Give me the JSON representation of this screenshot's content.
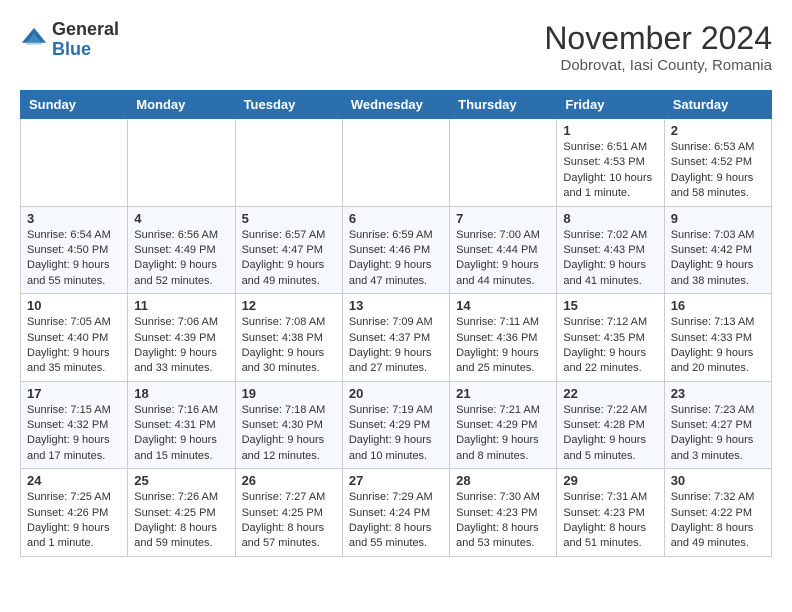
{
  "header": {
    "logo": {
      "general": "General",
      "blue": "Blue"
    },
    "title": "November 2024",
    "subtitle": "Dobrovat, Iasi County, Romania"
  },
  "calendar": {
    "days_of_week": [
      "Sunday",
      "Monday",
      "Tuesday",
      "Wednesday",
      "Thursday",
      "Friday",
      "Saturday"
    ],
    "weeks": [
      [
        {
          "day": "",
          "content": ""
        },
        {
          "day": "",
          "content": ""
        },
        {
          "day": "",
          "content": ""
        },
        {
          "day": "",
          "content": ""
        },
        {
          "day": "",
          "content": ""
        },
        {
          "day": "1",
          "content": "Sunrise: 6:51 AM\nSunset: 4:53 PM\nDaylight: 10 hours and 1 minute."
        },
        {
          "day": "2",
          "content": "Sunrise: 6:53 AM\nSunset: 4:52 PM\nDaylight: 9 hours and 58 minutes."
        }
      ],
      [
        {
          "day": "3",
          "content": "Sunrise: 6:54 AM\nSunset: 4:50 PM\nDaylight: 9 hours and 55 minutes."
        },
        {
          "day": "4",
          "content": "Sunrise: 6:56 AM\nSunset: 4:49 PM\nDaylight: 9 hours and 52 minutes."
        },
        {
          "day": "5",
          "content": "Sunrise: 6:57 AM\nSunset: 4:47 PM\nDaylight: 9 hours and 49 minutes."
        },
        {
          "day": "6",
          "content": "Sunrise: 6:59 AM\nSunset: 4:46 PM\nDaylight: 9 hours and 47 minutes."
        },
        {
          "day": "7",
          "content": "Sunrise: 7:00 AM\nSunset: 4:44 PM\nDaylight: 9 hours and 44 minutes."
        },
        {
          "day": "8",
          "content": "Sunrise: 7:02 AM\nSunset: 4:43 PM\nDaylight: 9 hours and 41 minutes."
        },
        {
          "day": "9",
          "content": "Sunrise: 7:03 AM\nSunset: 4:42 PM\nDaylight: 9 hours and 38 minutes."
        }
      ],
      [
        {
          "day": "10",
          "content": "Sunrise: 7:05 AM\nSunset: 4:40 PM\nDaylight: 9 hours and 35 minutes."
        },
        {
          "day": "11",
          "content": "Sunrise: 7:06 AM\nSunset: 4:39 PM\nDaylight: 9 hours and 33 minutes."
        },
        {
          "day": "12",
          "content": "Sunrise: 7:08 AM\nSunset: 4:38 PM\nDaylight: 9 hours and 30 minutes."
        },
        {
          "day": "13",
          "content": "Sunrise: 7:09 AM\nSunset: 4:37 PM\nDaylight: 9 hours and 27 minutes."
        },
        {
          "day": "14",
          "content": "Sunrise: 7:11 AM\nSunset: 4:36 PM\nDaylight: 9 hours and 25 minutes."
        },
        {
          "day": "15",
          "content": "Sunrise: 7:12 AM\nSunset: 4:35 PM\nDaylight: 9 hours and 22 minutes."
        },
        {
          "day": "16",
          "content": "Sunrise: 7:13 AM\nSunset: 4:33 PM\nDaylight: 9 hours and 20 minutes."
        }
      ],
      [
        {
          "day": "17",
          "content": "Sunrise: 7:15 AM\nSunset: 4:32 PM\nDaylight: 9 hours and 17 minutes."
        },
        {
          "day": "18",
          "content": "Sunrise: 7:16 AM\nSunset: 4:31 PM\nDaylight: 9 hours and 15 minutes."
        },
        {
          "day": "19",
          "content": "Sunrise: 7:18 AM\nSunset: 4:30 PM\nDaylight: 9 hours and 12 minutes."
        },
        {
          "day": "20",
          "content": "Sunrise: 7:19 AM\nSunset: 4:29 PM\nDaylight: 9 hours and 10 minutes."
        },
        {
          "day": "21",
          "content": "Sunrise: 7:21 AM\nSunset: 4:29 PM\nDaylight: 9 hours and 8 minutes."
        },
        {
          "day": "22",
          "content": "Sunrise: 7:22 AM\nSunset: 4:28 PM\nDaylight: 9 hours and 5 minutes."
        },
        {
          "day": "23",
          "content": "Sunrise: 7:23 AM\nSunset: 4:27 PM\nDaylight: 9 hours and 3 minutes."
        }
      ],
      [
        {
          "day": "24",
          "content": "Sunrise: 7:25 AM\nSunset: 4:26 PM\nDaylight: 9 hours and 1 minute."
        },
        {
          "day": "25",
          "content": "Sunrise: 7:26 AM\nSunset: 4:25 PM\nDaylight: 8 hours and 59 minutes."
        },
        {
          "day": "26",
          "content": "Sunrise: 7:27 AM\nSunset: 4:25 PM\nDaylight: 8 hours and 57 minutes."
        },
        {
          "day": "27",
          "content": "Sunrise: 7:29 AM\nSunset: 4:24 PM\nDaylight: 8 hours and 55 minutes."
        },
        {
          "day": "28",
          "content": "Sunrise: 7:30 AM\nSunset: 4:23 PM\nDaylight: 8 hours and 53 minutes."
        },
        {
          "day": "29",
          "content": "Sunrise: 7:31 AM\nSunset: 4:23 PM\nDaylight: 8 hours and 51 minutes."
        },
        {
          "day": "30",
          "content": "Sunrise: 7:32 AM\nSunset: 4:22 PM\nDaylight: 8 hours and 49 minutes."
        }
      ]
    ]
  }
}
